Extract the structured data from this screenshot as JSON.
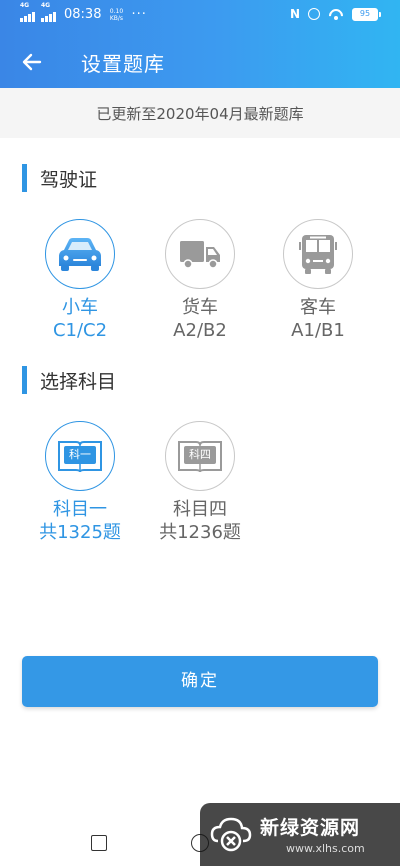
{
  "status_bar": {
    "network_1": "4G",
    "network_2": "4G",
    "time": "08:38",
    "speed_value": "0.10",
    "speed_unit": "KB/s",
    "dots": "···",
    "nfc": "N",
    "battery": "95"
  },
  "header": {
    "title": "设置题库"
  },
  "notice": "已更新至2020年04月最新题库",
  "license_section": {
    "title": "驾驶证",
    "options": [
      {
        "line1": "小车",
        "line2": "C1/C2",
        "selected": true,
        "icon": "car-icon"
      },
      {
        "line1": "货车",
        "line2": "A2/B2",
        "selected": false,
        "icon": "truck-icon"
      },
      {
        "line1": "客车",
        "line2": "A1/B1",
        "selected": false,
        "icon": "bus-icon"
      }
    ]
  },
  "subject_section": {
    "title": "选择科目",
    "options": [
      {
        "line1": "科目一",
        "line2": "共1325题",
        "book_label": "科一",
        "selected": true,
        "icon": "book-icon"
      },
      {
        "line1": "科目四",
        "line2": "共1236题",
        "book_label": "科四",
        "selected": false,
        "icon": "book-icon"
      }
    ]
  },
  "confirm_label": "确定",
  "watermark": {
    "text": "新绿资源网",
    "url": "www.xlhs.com"
  },
  "colors": {
    "accent": "#2f95e3",
    "inactive": "#9a9a9a"
  }
}
